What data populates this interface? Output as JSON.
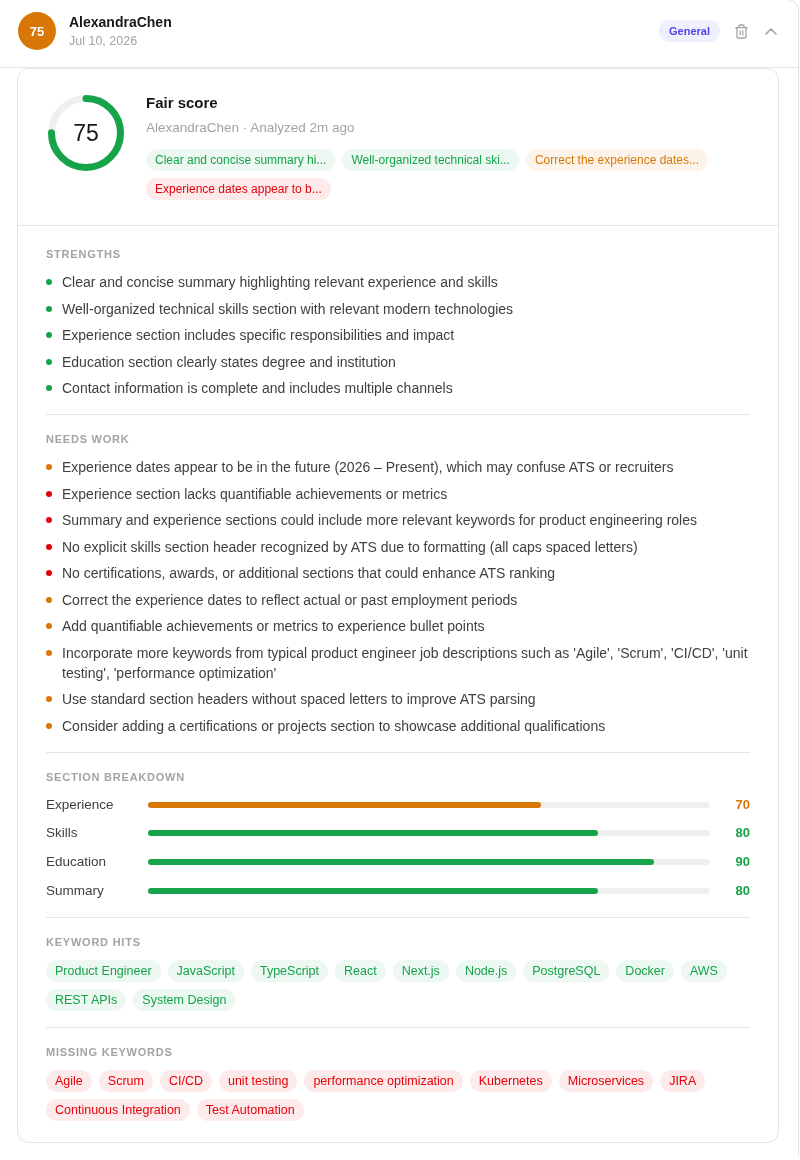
{
  "header": {
    "avatar": "75",
    "name": "AlexandraChen",
    "date": "Jul 10, 2026",
    "tag": "General",
    "expanded": true
  },
  "summary": {
    "score": "75",
    "level": 0.75,
    "title": "Fair score",
    "subtitle": "AlexandraChen · Analyzed 2m ago",
    "chips": [
      {
        "text": "Clear and concise summary hi...",
        "color": "#16a34a"
      },
      {
        "text": "Well-organized technical ski...",
        "color": "#16a34a"
      },
      {
        "text": "Correct the experience dates...",
        "color": "#d97706"
      },
      {
        "text": "Experience dates appear to b...",
        "color": "#e7000b"
      }
    ]
  },
  "strengths": {
    "title": "STRENGTHS",
    "items": [
      {
        "text": "Clear and concise summary highlighting relevant experience and skills",
        "color": "#16a34a"
      },
      {
        "text": "Well-organized technical skills section with relevant modern technologies",
        "color": "#16a34a"
      },
      {
        "text": "Experience section includes specific responsibilities and impact",
        "color": "#16a34a"
      },
      {
        "text": "Education section clearly states degree and institution",
        "color": "#16a34a"
      },
      {
        "text": "Contact information is complete and includes multiple channels",
        "color": "#16a34a"
      }
    ]
  },
  "needs_work": {
    "title": "NEEDS WORK",
    "items": [
      {
        "text": "Experience dates appear to be in the future (2026 – Present), which may confuse ATS or recruiters",
        "color": "#d97706"
      },
      {
        "text": "Experience section lacks quantifiable achievements or metrics",
        "color": "#e7000b"
      },
      {
        "text": "Summary and experience sections could include more relevant keywords for product engineering roles",
        "color": "#e7000b"
      },
      {
        "text": "No explicit skills section header recognized by ATS due to formatting (all caps spaced letters)",
        "color": "#e7000b"
      },
      {
        "text": "No certifications, awards, or additional sections that could enhance ATS ranking",
        "color": "#e7000b"
      },
      {
        "text": "Correct the experience dates to reflect actual or past employment periods",
        "color": "#d97706"
      },
      {
        "text": "Add quantifiable achievements or metrics to experience bullet points",
        "color": "#d97706"
      },
      {
        "text": "Incorporate more keywords from typical product engineer job descriptions such as 'Agile', 'Scrum', 'CI/CD', 'unit testing', 'performance optimization'",
        "color": "#d97706"
      },
      {
        "text": "Use standard section headers without spaced letters to improve ATS parsing",
        "color": "#d97706"
      },
      {
        "text": "Consider adding a certifications or projects section to showcase additional qualifications",
        "color": "#d97706"
      }
    ]
  },
  "section_breakdown": {
    "title": "SECTION BREAKDOWN",
    "rows": [
      {
        "label": "Experience",
        "level": 0.7,
        "value": "70",
        "color": "#d97706"
      },
      {
        "label": "Skills",
        "level": 0.8,
        "value": "80",
        "color": "#16a34a"
      },
      {
        "label": "Education",
        "level": 0.9,
        "value": "90",
        "color": "#16a34a"
      },
      {
        "label": "Summary",
        "level": 0.8,
        "value": "80",
        "color": "#16a34a"
      }
    ]
  },
  "keyword_hits": {
    "title": "KEYWORD HITS",
    "found": true,
    "keywords": [
      "Product Engineer",
      "JavaScript",
      "TypeScript",
      "React",
      "Next.js",
      "Node.js",
      "PostgreSQL",
      "Docker",
      "AWS",
      "REST APIs",
      "System Design"
    ]
  },
  "missing_keywords": {
    "title": "MISSING KEYWORDS",
    "found": false,
    "keywords": [
      "Agile",
      "Scrum",
      "CI/CD",
      "unit testing",
      "performance optimization",
      "Kubernetes",
      "Microservices",
      "JIRA",
      "Continuous Integration",
      "Test Automation"
    ]
  }
}
